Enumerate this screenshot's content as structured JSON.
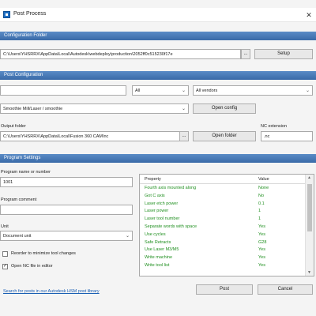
{
  "window": {
    "title": "Post Process",
    "close_glyph": "✕"
  },
  "config_folder": {
    "header": "Configuration Folder",
    "path": "C:\\Users\\YHSRRX\\AppData\\Local\\Autodesk\\webdeploy\\production\\2052ff0c515230f17e",
    "browse_label": "...",
    "setup_label": "Setup"
  },
  "post_config": {
    "header": "Post Configuration",
    "search_value": "",
    "filter_value": "All",
    "vendor_value": "All vendors",
    "post_value": "Smoothie Mill/Laser / smoothie",
    "open_config_label": "Open config"
  },
  "output": {
    "folder_label": "Output folder",
    "folder_path": "C:\\Users\\YHSRRX\\AppData\\Local\\Fusion 360 CAM\\nc",
    "browse_label": "...",
    "open_folder_label": "Open folder",
    "ext_label": "NC extension",
    "ext_value": ".nc"
  },
  "program": {
    "header": "Program Settings",
    "name_label": "Program name or number",
    "name_value": "1001",
    "comment_label": "Program comment",
    "comment_value": "",
    "unit_label": "Unit",
    "unit_value": "Document unit",
    "reorder_label": "Reorder to minimize tool changes",
    "reorder_checked": false,
    "open_nc_label": "Open NC file in editor",
    "open_nc_checked": true
  },
  "properties": {
    "col_property": "Property",
    "col_value": "Value",
    "text_color": "#1f8f1f",
    "rows": [
      {
        "name": "Fourth axis mounted along",
        "value": "None"
      },
      {
        "name": "Got C axis",
        "value": "No"
      },
      {
        "name": "Laser etch power",
        "value": "0.1"
      },
      {
        "name": "Laser power",
        "value": "1"
      },
      {
        "name": "Laser tool number",
        "value": "1"
      },
      {
        "name": "Separate words with space",
        "value": "Yes"
      },
      {
        "name": "Use cycles",
        "value": "Yes"
      },
      {
        "name": "Safe Retracts",
        "value": "G28"
      },
      {
        "name": "Use Laser M3/M5",
        "value": "Yes"
      },
      {
        "name": "Write machine",
        "value": "Yes"
      },
      {
        "name": "Write tool list",
        "value": "Yes"
      }
    ]
  },
  "footer": {
    "library_link": "Search for posts in our Autodesk HSM post library",
    "post_label": "Post",
    "cancel_label": "Cancel"
  },
  "colors": {
    "section_header": "#4a7ab8",
    "link": "#1a5fb4"
  }
}
